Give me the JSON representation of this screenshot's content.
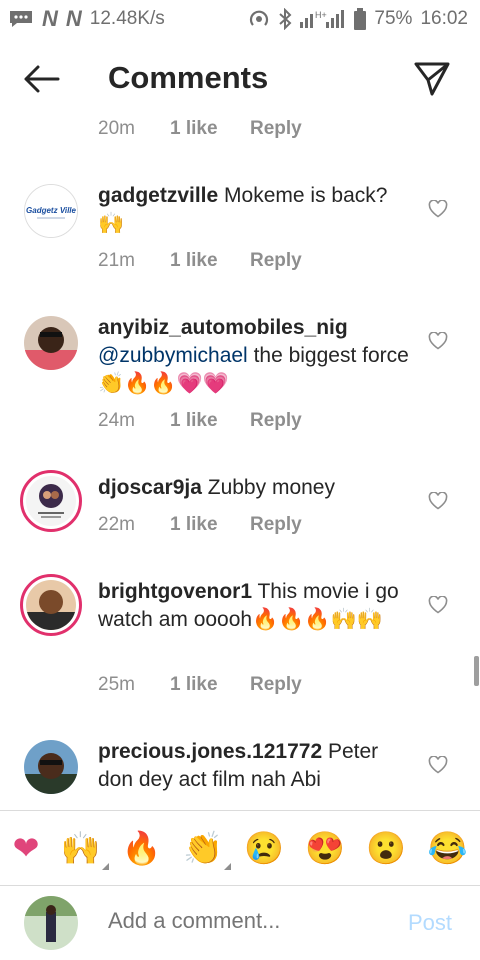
{
  "status_bar": {
    "speed": "12.48K/s",
    "network_label": "H+",
    "battery": "75%",
    "time": "16:02"
  },
  "header": {
    "title": "Comments",
    "back_icon": "arrow-left-icon",
    "send_icon": "paper-plane-icon"
  },
  "top_meta": {
    "time": "20m",
    "likes": "1 like",
    "reply": "Reply"
  },
  "comments": [
    {
      "username": "gadgetzville",
      "text": "Mokeme is back? 🙌",
      "time": "21m",
      "likes": "1 like",
      "reply": "Reply",
      "avatar_text": "Gadgetz Ville"
    },
    {
      "username": "anyibiz_automobiles_nig",
      "mention": "@zubbymichael",
      "text": "the biggest force👏🔥🔥💗💗",
      "time": "24m",
      "likes": "1 like",
      "reply": "Reply"
    },
    {
      "username": "djoscar9ja",
      "text": "Zubby money",
      "time": "22m",
      "likes": "1 like",
      "reply": "Reply"
    },
    {
      "username": "brightgovenor1",
      "text": "This movie i go watch am ooooh🔥🔥🔥🙌🙌",
      "time": "25m",
      "likes": "1 like",
      "reply": "Reply"
    },
    {
      "username": "precious.jones.121772",
      "text": "Peter don dey act film nah Abi"
    }
  ],
  "emoji_bar": [
    "❤",
    "🙌",
    "🔥",
    "👏",
    "😢",
    "😍",
    "😮",
    "😂"
  ],
  "composer": {
    "placeholder": "Add a comment...",
    "post_label": "Post"
  },
  "colors": {
    "mention": "#003569",
    "story_ring": "#e1306c",
    "post_disabled": "#b3dbff"
  }
}
